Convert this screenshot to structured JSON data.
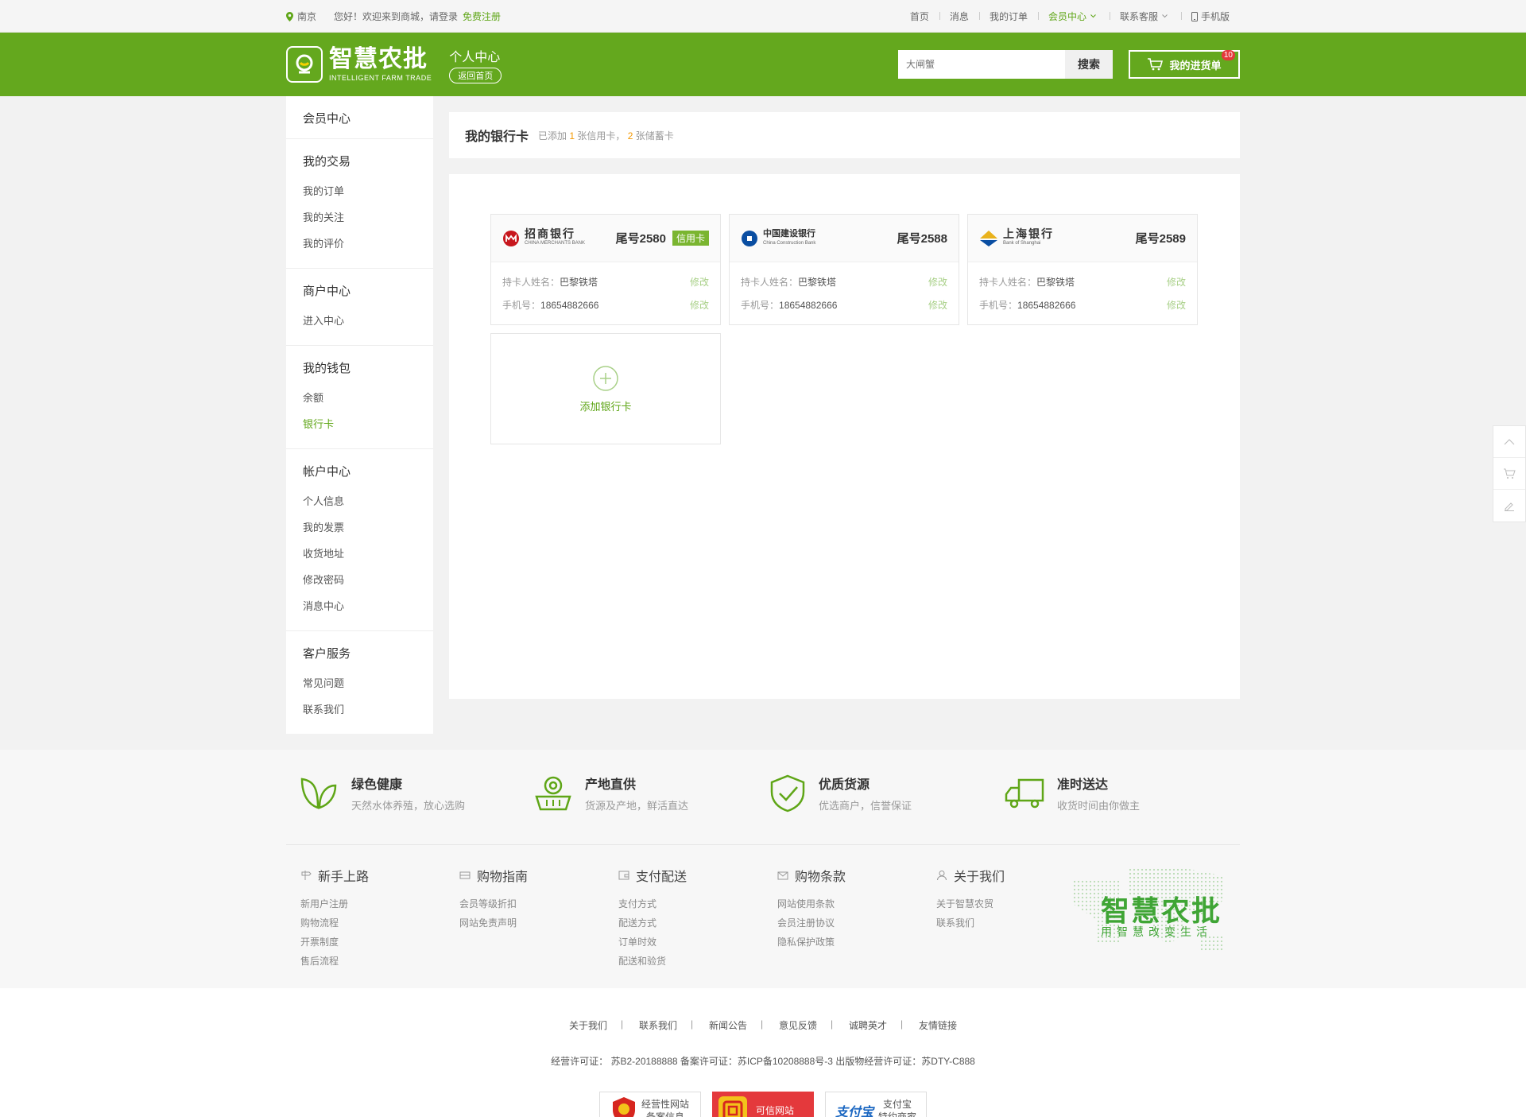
{
  "topbar": {
    "location": "南京",
    "greeting": "您好！欢迎来到商城，请登录",
    "register": "免费注册",
    "nav": [
      "首页",
      "消息",
      "我的订单",
      "会员中心",
      "联系客服",
      "手机版"
    ]
  },
  "header": {
    "logo_cn": "智慧农批",
    "logo_en": "INTELLIGENT FARM TRADE",
    "section_title": "个人中心",
    "back_home": "返回首页",
    "search_placeholder": "大闸蟹",
    "search_button": "搜索",
    "cart_label": "我的进货单",
    "cart_count": "10"
  },
  "sidebar": {
    "title": "会员中心",
    "groups": [
      {
        "title": "我的交易",
        "items": [
          "我的订单",
          "我的关注",
          "我的评价"
        ]
      },
      {
        "title": "商户中心",
        "items": [
          "进入中心"
        ]
      },
      {
        "title": "我的钱包",
        "items": [
          "余额",
          "银行卡"
        ]
      },
      {
        "title": "帐户中心",
        "items": [
          "个人信息",
          "我的发票",
          "收货地址",
          "修改密码",
          "消息中心"
        ]
      },
      {
        "title": "客户服务",
        "items": [
          "常见问题",
          "联系我们"
        ]
      }
    ],
    "active_item": "银行卡"
  },
  "content": {
    "title": "我的银行卡",
    "summary_prefix": "已添加",
    "credit_count": "1",
    "credit_label": "张信用卡，",
    "debit_count": "2",
    "debit_label": "张储蓄卡",
    "cards": [
      {
        "bank_cn": "招商银行",
        "bank_en": "CHINA MERCHANTS BANK",
        "tail": "尾号2580",
        "tag": "信用卡",
        "holder_label": "持卡人姓名：",
        "holder": "巴黎铁塔",
        "phone_label": "手机号：",
        "phone": "18654882666",
        "edit": "修改",
        "color": "#c7161d"
      },
      {
        "bank_cn": "中国建设银行",
        "bank_en": "China Construction Bank",
        "tail": "尾号2588",
        "tag": "",
        "holder_label": "持卡人姓名：",
        "holder": "巴黎铁塔",
        "phone_label": "手机号：",
        "phone": "18654882666",
        "edit": "修改",
        "color": "#0a4ea2"
      },
      {
        "bank_cn": "上海银行",
        "bank_en": "Bank of Shanghai",
        "tail": "尾号2589",
        "tag": "",
        "holder_label": "持卡人姓名：",
        "holder": "巴黎铁塔",
        "phone_label": "手机号：",
        "phone": "18654882666",
        "edit": "修改",
        "color": "#e9b21c"
      }
    ],
    "add_card": "添加银行卡"
  },
  "features": [
    {
      "title": "绿色健康",
      "desc": "天然水体养殖，放心选购",
      "icon": "leaf-icon"
    },
    {
      "title": "产地直供",
      "desc": "货源及产地，鲜活直达",
      "icon": "basket-icon"
    },
    {
      "title": "优质货源",
      "desc": "优选商户，信誉保证",
      "icon": "shield-check-icon"
    },
    {
      "title": "准时送达",
      "desc": "收货时间由你做主",
      "icon": "truck-icon"
    }
  ],
  "footer_links": [
    {
      "title": "新手上路",
      "items": [
        "新用户注册",
        "购物流程",
        "开票制度",
        "售后流程"
      ]
    },
    {
      "title": "购物指南",
      "items": [
        "会员等级折扣",
        "网站免责声明"
      ]
    },
    {
      "title": "支付配送",
      "items": [
        "支付方式",
        "配送方式",
        "订单时效",
        "配送和验货"
      ]
    },
    {
      "title": "购物条款",
      "items": [
        "网站使用条款",
        "会员注册协议",
        "隐私保护政策"
      ]
    },
    {
      "title": "关于我们",
      "items": [
        "关于智慧农贸",
        "联系我们"
      ]
    }
  ],
  "brand": {
    "name": "智慧农批",
    "slogan": "用智慧改变生活"
  },
  "bottom": {
    "nav": [
      "关于我们",
      "联系我们",
      "新闻公告",
      "意见反馈",
      "诚聘英才",
      "友情链接"
    ],
    "license": "经营许可证： 苏B2-20188888 备案许可证：苏ICP备10208888号-3 出版物经营许可证：苏DTY-C888",
    "certs": [
      {
        "line1": "经营性网站",
        "line2": "备案信息"
      },
      {
        "line1": "可信网站",
        "line2": ""
      },
      {
        "line1": "支付宝",
        "line2": "特约商家",
        "logo": "支付宝"
      }
    ]
  },
  "colors": {
    "brand_green": "#64a81e",
    "accent_orange": "#f39800"
  }
}
